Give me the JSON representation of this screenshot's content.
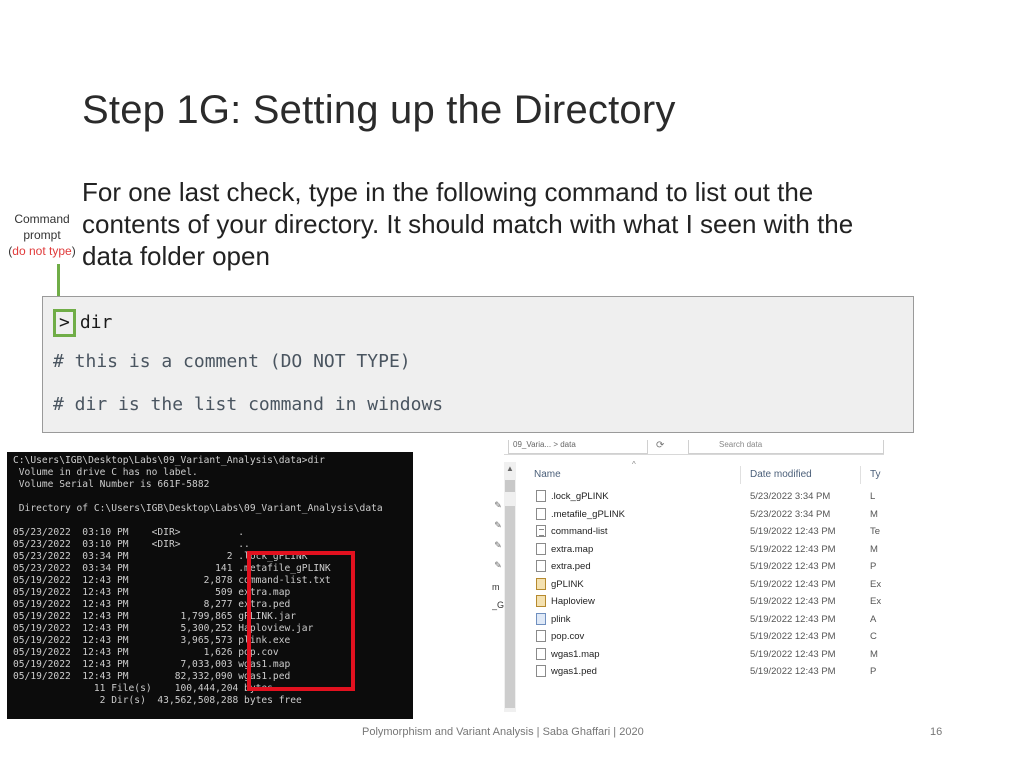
{
  "slide": {
    "title": "Step 1G: Setting up the Directory",
    "body_line1": "For one last check, type in the following command to list out the",
    "body_line2": "contents of your directory. It should match with what I seen with the",
    "body_highlight": "data",
    "body_line3_rest": " folder open",
    "side_note_1": "Command",
    "side_note_2": "prompt",
    "side_note_3_open": "(",
    "side_note_3_red": "do not type",
    "side_note_3_close": ")",
    "footer": "Polymorphism and Variant Analysis | Saba Ghaffari | 2020",
    "page_number": "16"
  },
  "code": {
    "prompt": ">",
    "command": "dir",
    "comment1": "# this is a comment (DO NOT TYPE)",
    "comment2": "# dir is the list command in windows"
  },
  "cmd": {
    "lines": [
      "C:\\Users\\IGB\\Desktop\\Labs\\09_Variant_Analysis\\data>dir",
      " Volume in drive C has no label.",
      " Volume Serial Number is 661F-5882",
      "",
      " Directory of C:\\Users\\IGB\\Desktop\\Labs\\09_Variant_Analysis\\data",
      "",
      "05/23/2022  03:10 PM    <DIR>          .",
      "05/23/2022  03:10 PM    <DIR>          ..",
      "05/23/2022  03:34 PM                 2 .lock_gPLINK",
      "05/23/2022  03:34 PM               141 .metafile_gPLINK",
      "05/19/2022  12:43 PM             2,878 command-list.txt",
      "05/19/2022  12:43 PM               509 extra.map",
      "05/19/2022  12:43 PM             8,277 extra.ped",
      "05/19/2022  12:43 PM         1,799,865 gPLINK.jar",
      "05/19/2022  12:43 PM         5,300,252 Haploview.jar",
      "05/19/2022  12:43 PM         3,965,573 plink.exe",
      "05/19/2022  12:43 PM             1,626 pop.cov",
      "05/19/2022  12:43 PM         7,033,003 wgas1.map",
      "05/19/2022  12:43 PM        82,332,090 wgas1.ped",
      "              11 File(s)    100,444,204 bytes",
      "               2 Dir(s)  43,562,508,288 bytes free"
    ]
  },
  "explorer": {
    "crumb": "09_Varia... > data",
    "search_placeholder": "Search data",
    "col_name": "Name",
    "col_date": "Date modified",
    "col_type": "Ty",
    "side_chars": [
      "m",
      "_G"
    ],
    "rows": [
      {
        "name": ".lock_gPLINK",
        "date": "5/23/2022 3:34 PM",
        "type": "L",
        "icon": "file"
      },
      {
        "name": ".metafile_gPLINK",
        "date": "5/23/2022 3:34 PM",
        "type": "M",
        "icon": "file"
      },
      {
        "name": "command-list",
        "date": "5/19/2022 12:43 PM",
        "type": "Te",
        "icon": "txt"
      },
      {
        "name": "extra.map",
        "date": "5/19/2022 12:43 PM",
        "type": "M",
        "icon": "file"
      },
      {
        "name": "extra.ped",
        "date": "5/19/2022 12:43 PM",
        "type": "P",
        "icon": "file"
      },
      {
        "name": "gPLINK",
        "date": "5/19/2022 12:43 PM",
        "type": "Ex",
        "icon": "jar"
      },
      {
        "name": "Haploview",
        "date": "5/19/2022 12:43 PM",
        "type": "Ex",
        "icon": "jar"
      },
      {
        "name": "plink",
        "date": "5/19/2022 12:43 PM",
        "type": "A",
        "icon": "exe"
      },
      {
        "name": "pop.cov",
        "date": "5/19/2022 12:43 PM",
        "type": "C",
        "icon": "file"
      },
      {
        "name": "wgas1.map",
        "date": "5/19/2022 12:43 PM",
        "type": "M",
        "icon": "file"
      },
      {
        "name": "wgas1.ped",
        "date": "5/19/2022 12:43 PM",
        "type": "P",
        "icon": "file"
      }
    ]
  }
}
